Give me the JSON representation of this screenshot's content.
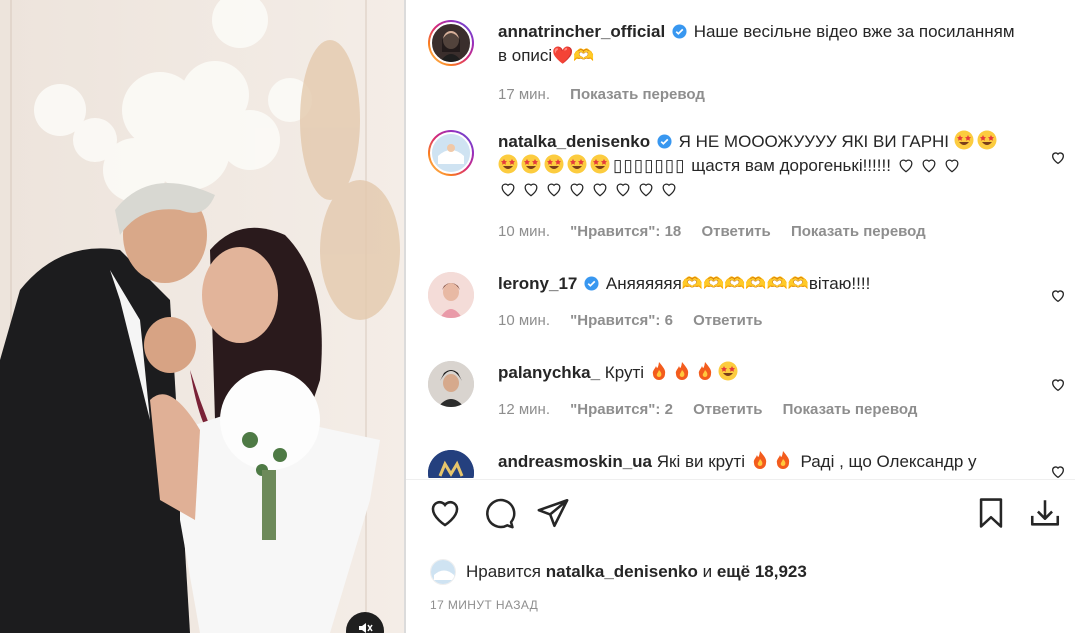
{
  "media": {
    "mute_icon": "speaker-muted-icon"
  },
  "caption": {
    "username": "annatrincher_official",
    "text": "Наше весільне відео вже за посиланням в описі❤️",
    "trailing_glyph": "🫶",
    "time": "17 мин.",
    "translate": "Показать перевод"
  },
  "comments": [
    {
      "username": "natalka_denisenko",
      "verified": true,
      "text_line1": "Я НЕ МОООЖУУУУ ЯКІ ВИ ГАРНІ",
      "text_line2": "щастя вам дорогенькі!!!!!!",
      "time": "10 мин.",
      "likes": "\"Нравится\": 18",
      "reply": "Ответить",
      "translate": "Показать перевод"
    },
    {
      "username": "lerony_17",
      "verified": true,
      "text": "Аняяяяяя🫶🫶🫶🫶🫶🫶вітаю!!!!",
      "time": "10 мин.",
      "likes": "\"Нравится\": 6",
      "reply": "Ответить"
    },
    {
      "username": "palanychka_",
      "verified": false,
      "text": "Круті",
      "time": "12 мин.",
      "likes": "\"Нравится\": 2",
      "reply": "Ответить",
      "translate": "Показать перевод"
    },
    {
      "username": "andreasmoskin_ua",
      "verified": false,
      "text": "Які ви круті",
      "text_tail": "Раді , що Олександр у"
    }
  ],
  "actions": {
    "like_icon": "heart-icon",
    "comment_icon": "comment-icon",
    "share_icon": "share-icon",
    "save_icon": "bookmark-icon",
    "download_icon": "download-icon"
  },
  "likes_line": {
    "prefix": "Нравится",
    "user": "natalka_denisenko",
    "middle": "и",
    "count": "ещё 18,923"
  },
  "posted_ago": "17 МИНУТ НАЗАД",
  "colors": {
    "verified": "#3897f0",
    "meta": "#8e8e8e",
    "text": "#262626"
  }
}
